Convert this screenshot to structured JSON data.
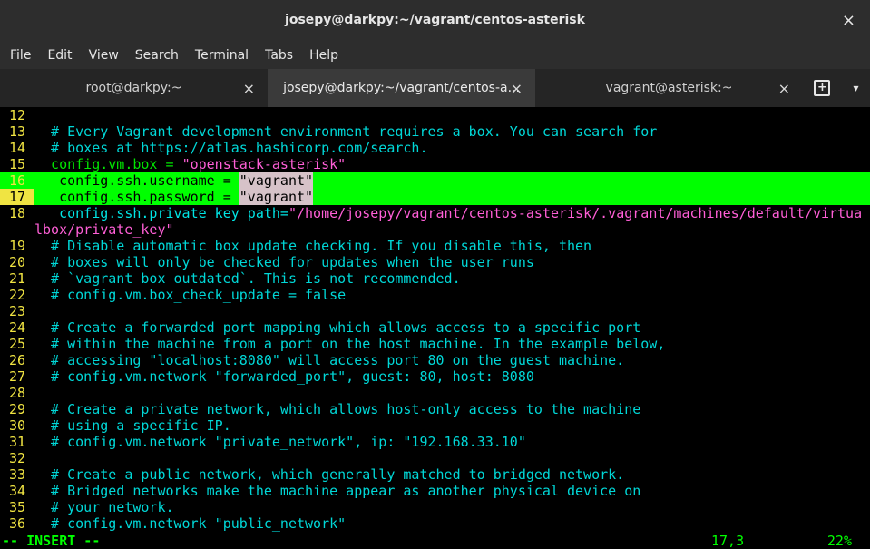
{
  "window": {
    "title": "josepy@darkpy:~/vagrant/centos-asterisk"
  },
  "menu": [
    "File",
    "Edit",
    "View",
    "Search",
    "Terminal",
    "Tabs",
    "Help"
  ],
  "tabs": [
    {
      "label": "root@darkpy:~"
    },
    {
      "label": "josepy@darkpy:~/vagrant/centos-a..."
    },
    {
      "label": "vagrant@asterisk:~"
    }
  ],
  "icons": {
    "close": "×",
    "new_tab": "+",
    "dropdown": "▾"
  },
  "editor": {
    "lines": [
      {
        "n": "12",
        "text": ""
      },
      {
        "n": "13",
        "text": "  # Every Vagrant development environment requires a box. You can search for"
      },
      {
        "n": "14",
        "text": "  # boxes at https://atlas.hashicorp.com/search."
      },
      {
        "n": "15",
        "text_a": "  config.vm.box = ",
        "str": "\"openstack-asterisk\""
      },
      {
        "n": "16",
        "text_a": "   config.ssh.username = ",
        "str": "\"vagrant\""
      },
      {
        "n": "17",
        "text_a": "   config.ssh.password = ",
        "str": "\"vagrant\""
      },
      {
        "n": "18",
        "text_a": "   config.ssh.private_key_path=",
        "str": "\"/home/josepy/vagrant/centos-asterisk/.vagrant/machines/default/virtua"
      },
      {
        "n": "",
        "str": "lbox/private_key\""
      },
      {
        "n": "19",
        "text": "  # Disable automatic box update checking. If you disable this, then"
      },
      {
        "n": "20",
        "text": "  # boxes will only be checked for updates when the user runs"
      },
      {
        "n": "21",
        "text": "  # `vagrant box outdated`. This is not recommended."
      },
      {
        "n": "22",
        "text": "  # config.vm.box_check_update = false"
      },
      {
        "n": "23",
        "text": ""
      },
      {
        "n": "24",
        "text": "  # Create a forwarded port mapping which allows access to a specific port"
      },
      {
        "n": "25",
        "text": "  # within the machine from a port on the host machine. In the example below,"
      },
      {
        "n": "26",
        "text": "  # accessing \"localhost:8080\" will access port 80 on the guest machine."
      },
      {
        "n": "27",
        "text": "  # config.vm.network \"forwarded_port\", guest: 80, host: 8080"
      },
      {
        "n": "28",
        "text": ""
      },
      {
        "n": "29",
        "text": "  # Create a private network, which allows host-only access to the machine"
      },
      {
        "n": "30",
        "text": "  # using a specific IP."
      },
      {
        "n": "31",
        "text": "  # config.vm.network \"private_network\", ip: \"192.168.33.10\""
      },
      {
        "n": "32",
        "text": ""
      },
      {
        "n": "33",
        "text": "  # Create a public network, which generally matched to bridged network."
      },
      {
        "n": "34",
        "text": "  # Bridged networks make the machine appear as another physical device on"
      },
      {
        "n": "35",
        "text": "  # your network."
      },
      {
        "n": "36",
        "text": "  # config.vm.network \"public_network\""
      }
    ],
    "status": {
      "mode": "-- INSERT --",
      "position": "17,3",
      "percent": "22%"
    }
  }
}
